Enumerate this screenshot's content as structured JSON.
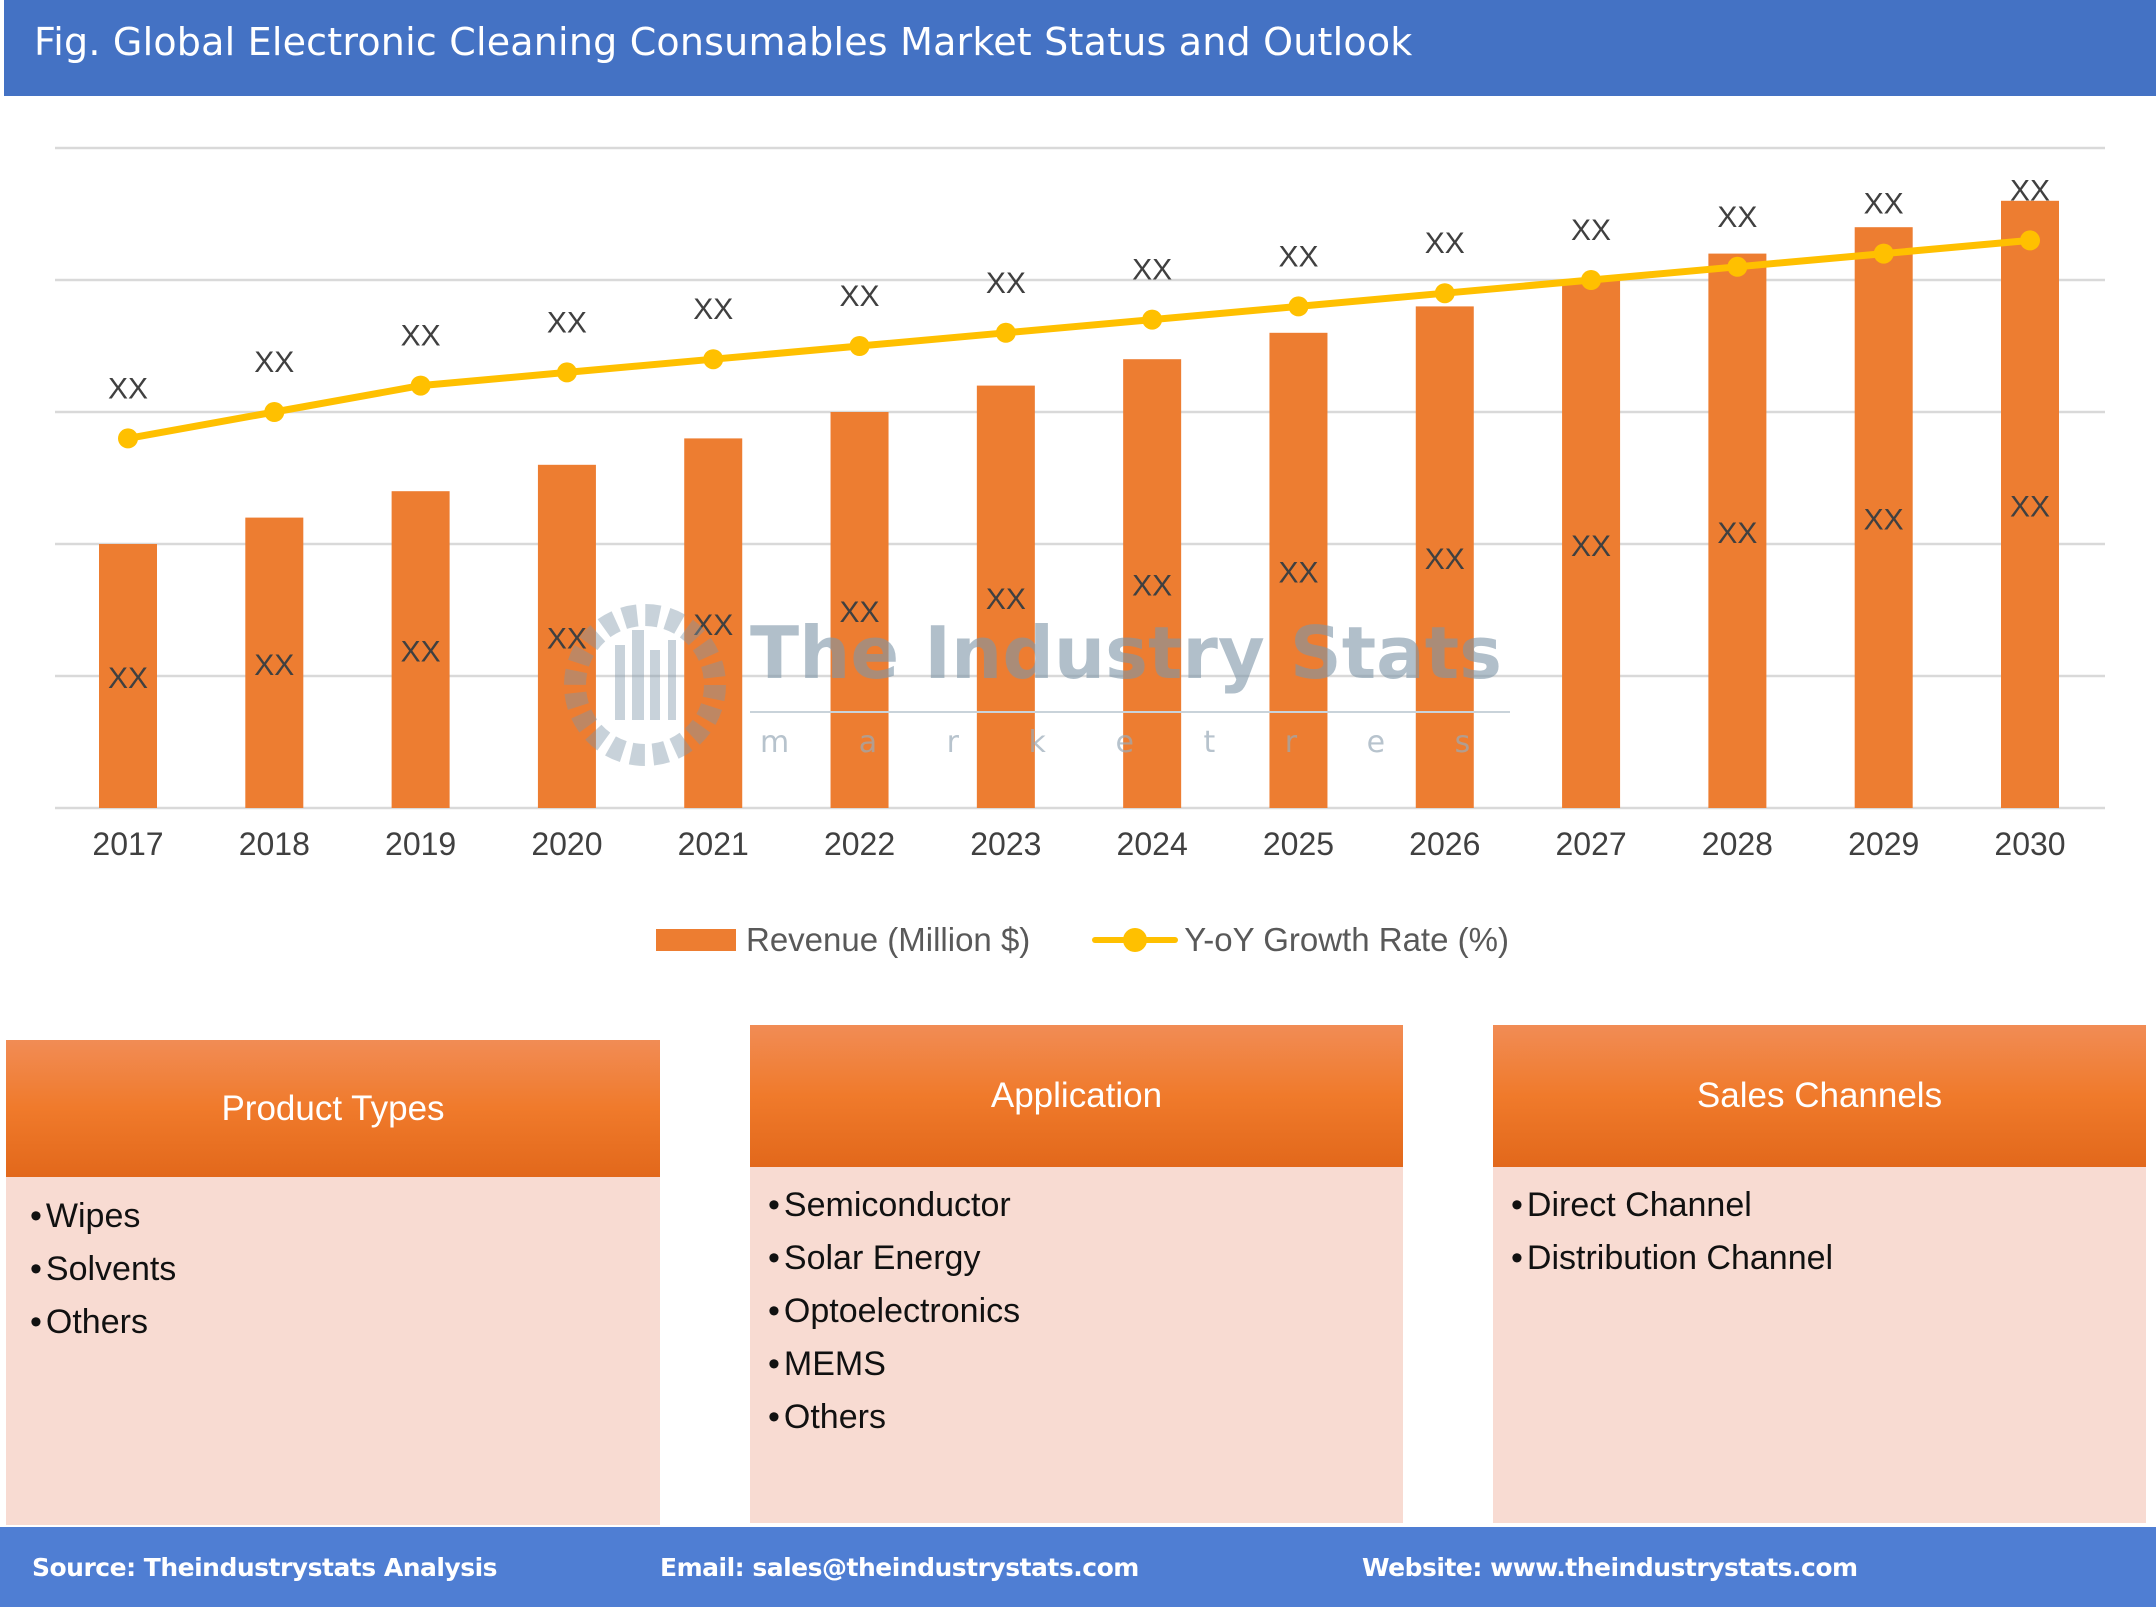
{
  "header": {
    "title": "Fig. Global Electronic Cleaning Consumables Market Status and Outlook"
  },
  "colors": {
    "header_bg": "#4472c4",
    "bar": "#ed7d31",
    "line": "#ffc000",
    "panel_header": "#f07a2b",
    "panel_body": "#f8dbd2",
    "footer_bg": "#4f7ed3"
  },
  "chart_data": {
    "type": "bar",
    "title": "Global Electronic Cleaning Consumables Market Status and Outlook",
    "xlabel": "",
    "ylabel": "",
    "grid": true,
    "ylim": [
      0,
      5
    ],
    "y_ticks_shown": false,
    "categories": [
      "2017",
      "2018",
      "2019",
      "2020",
      "2021",
      "2022",
      "2023",
      "2024",
      "2025",
      "2026",
      "2027",
      "2028",
      "2029",
      "2030"
    ],
    "series": [
      {
        "name": "Revenue (Million $)",
        "type": "bar",
        "values": [
          2.0,
          2.2,
          2.4,
          2.6,
          2.8,
          3.0,
          3.2,
          3.4,
          3.6,
          3.8,
          4.0,
          4.2,
          4.4,
          4.6
        ],
        "data_labels": [
          "XX",
          "XX",
          "XX",
          "XX",
          "XX",
          "XX",
          "XX",
          "XX",
          "XX",
          "XX",
          "XX",
          "XX",
          "XX",
          "XX"
        ]
      },
      {
        "name": "Y-oY Growth Rate (%)",
        "type": "line",
        "values": [
          2.8,
          3.0,
          3.2,
          3.3,
          3.4,
          3.5,
          3.6,
          3.7,
          3.8,
          3.9,
          4.0,
          4.1,
          4.2,
          4.3
        ],
        "data_labels": [
          "XX",
          "XX",
          "XX",
          "XX",
          "XX",
          "XX",
          "XX",
          "XX",
          "XX",
          "XX",
          "XX",
          "XX",
          "XX",
          "XX"
        ]
      }
    ],
    "legend": {
      "position": "bottom",
      "entries": [
        "Revenue (Million $)",
        "Y-oY Growth Rate (%)"
      ]
    },
    "note": "Values are masked as 'XX' in the figure; numeric values are relative estimates read from gridlines."
  },
  "watermark": {
    "title": "The Industry Stats",
    "subtitle": "m a r k e t   r e s e a r c h"
  },
  "panels": [
    {
      "title": "Product Types",
      "items": [
        "Wipes",
        "Solvents",
        "Others"
      ]
    },
    {
      "title": "Application",
      "items": [
        "Semiconductor",
        "Solar Energy",
        "Optoelectronics",
        "MEMS",
        "Others"
      ]
    },
    {
      "title": "Sales Channels",
      "items": [
        "Direct Channel",
        "Distribution Channel"
      ]
    }
  ],
  "bullet": "•",
  "footer": {
    "source": "Source: Theindustrystats Analysis",
    "email": "Email: sales@theindustrystats.com",
    "website": "Website: www.theindustrystats.com"
  }
}
